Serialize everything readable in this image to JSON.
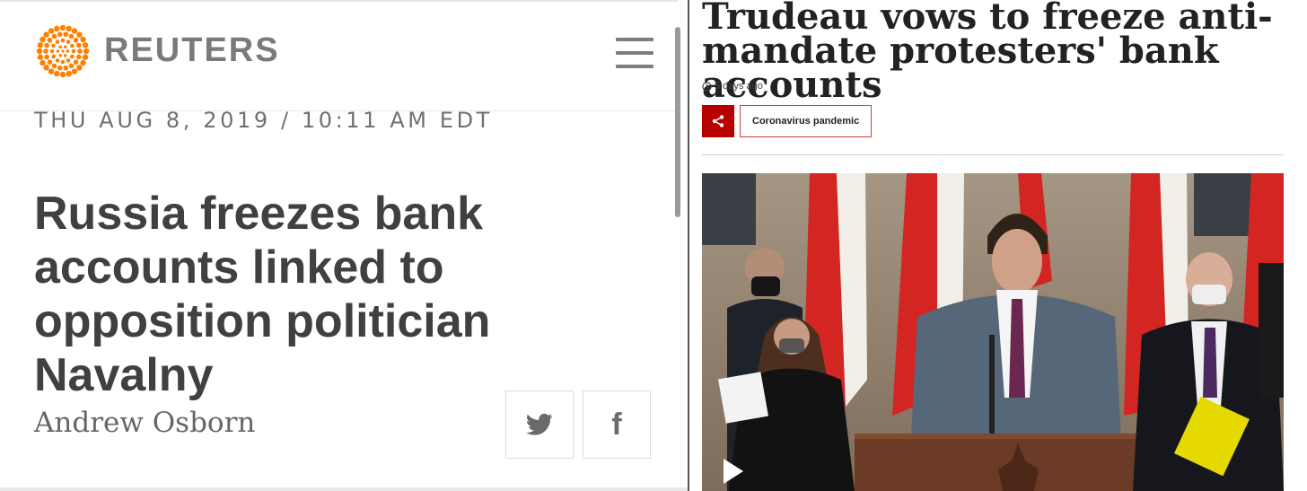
{
  "reuters": {
    "brand": "REUTERS",
    "dateline": "THU AUG 8, 2019 / 10:11 AM EDT",
    "headline": "Russia freezes bank accounts linked to opposition politician Navalny",
    "byline": "Andrew Osborn",
    "brand_color": "#ff8000",
    "icons": [
      "reuters-logo-icon",
      "menu-icon",
      "twitter-icon",
      "facebook-icon"
    ],
    "facebook_glyph": "f"
  },
  "bbc": {
    "headline": "Trudeau vows to freeze anti-mandate protesters' bank accounts",
    "timestamp": "5 days ago",
    "tag": "Coronavirus pandemic",
    "accent_color": "#b80000",
    "icons": [
      "clock-icon",
      "share-icon",
      "play-icon"
    ]
  }
}
